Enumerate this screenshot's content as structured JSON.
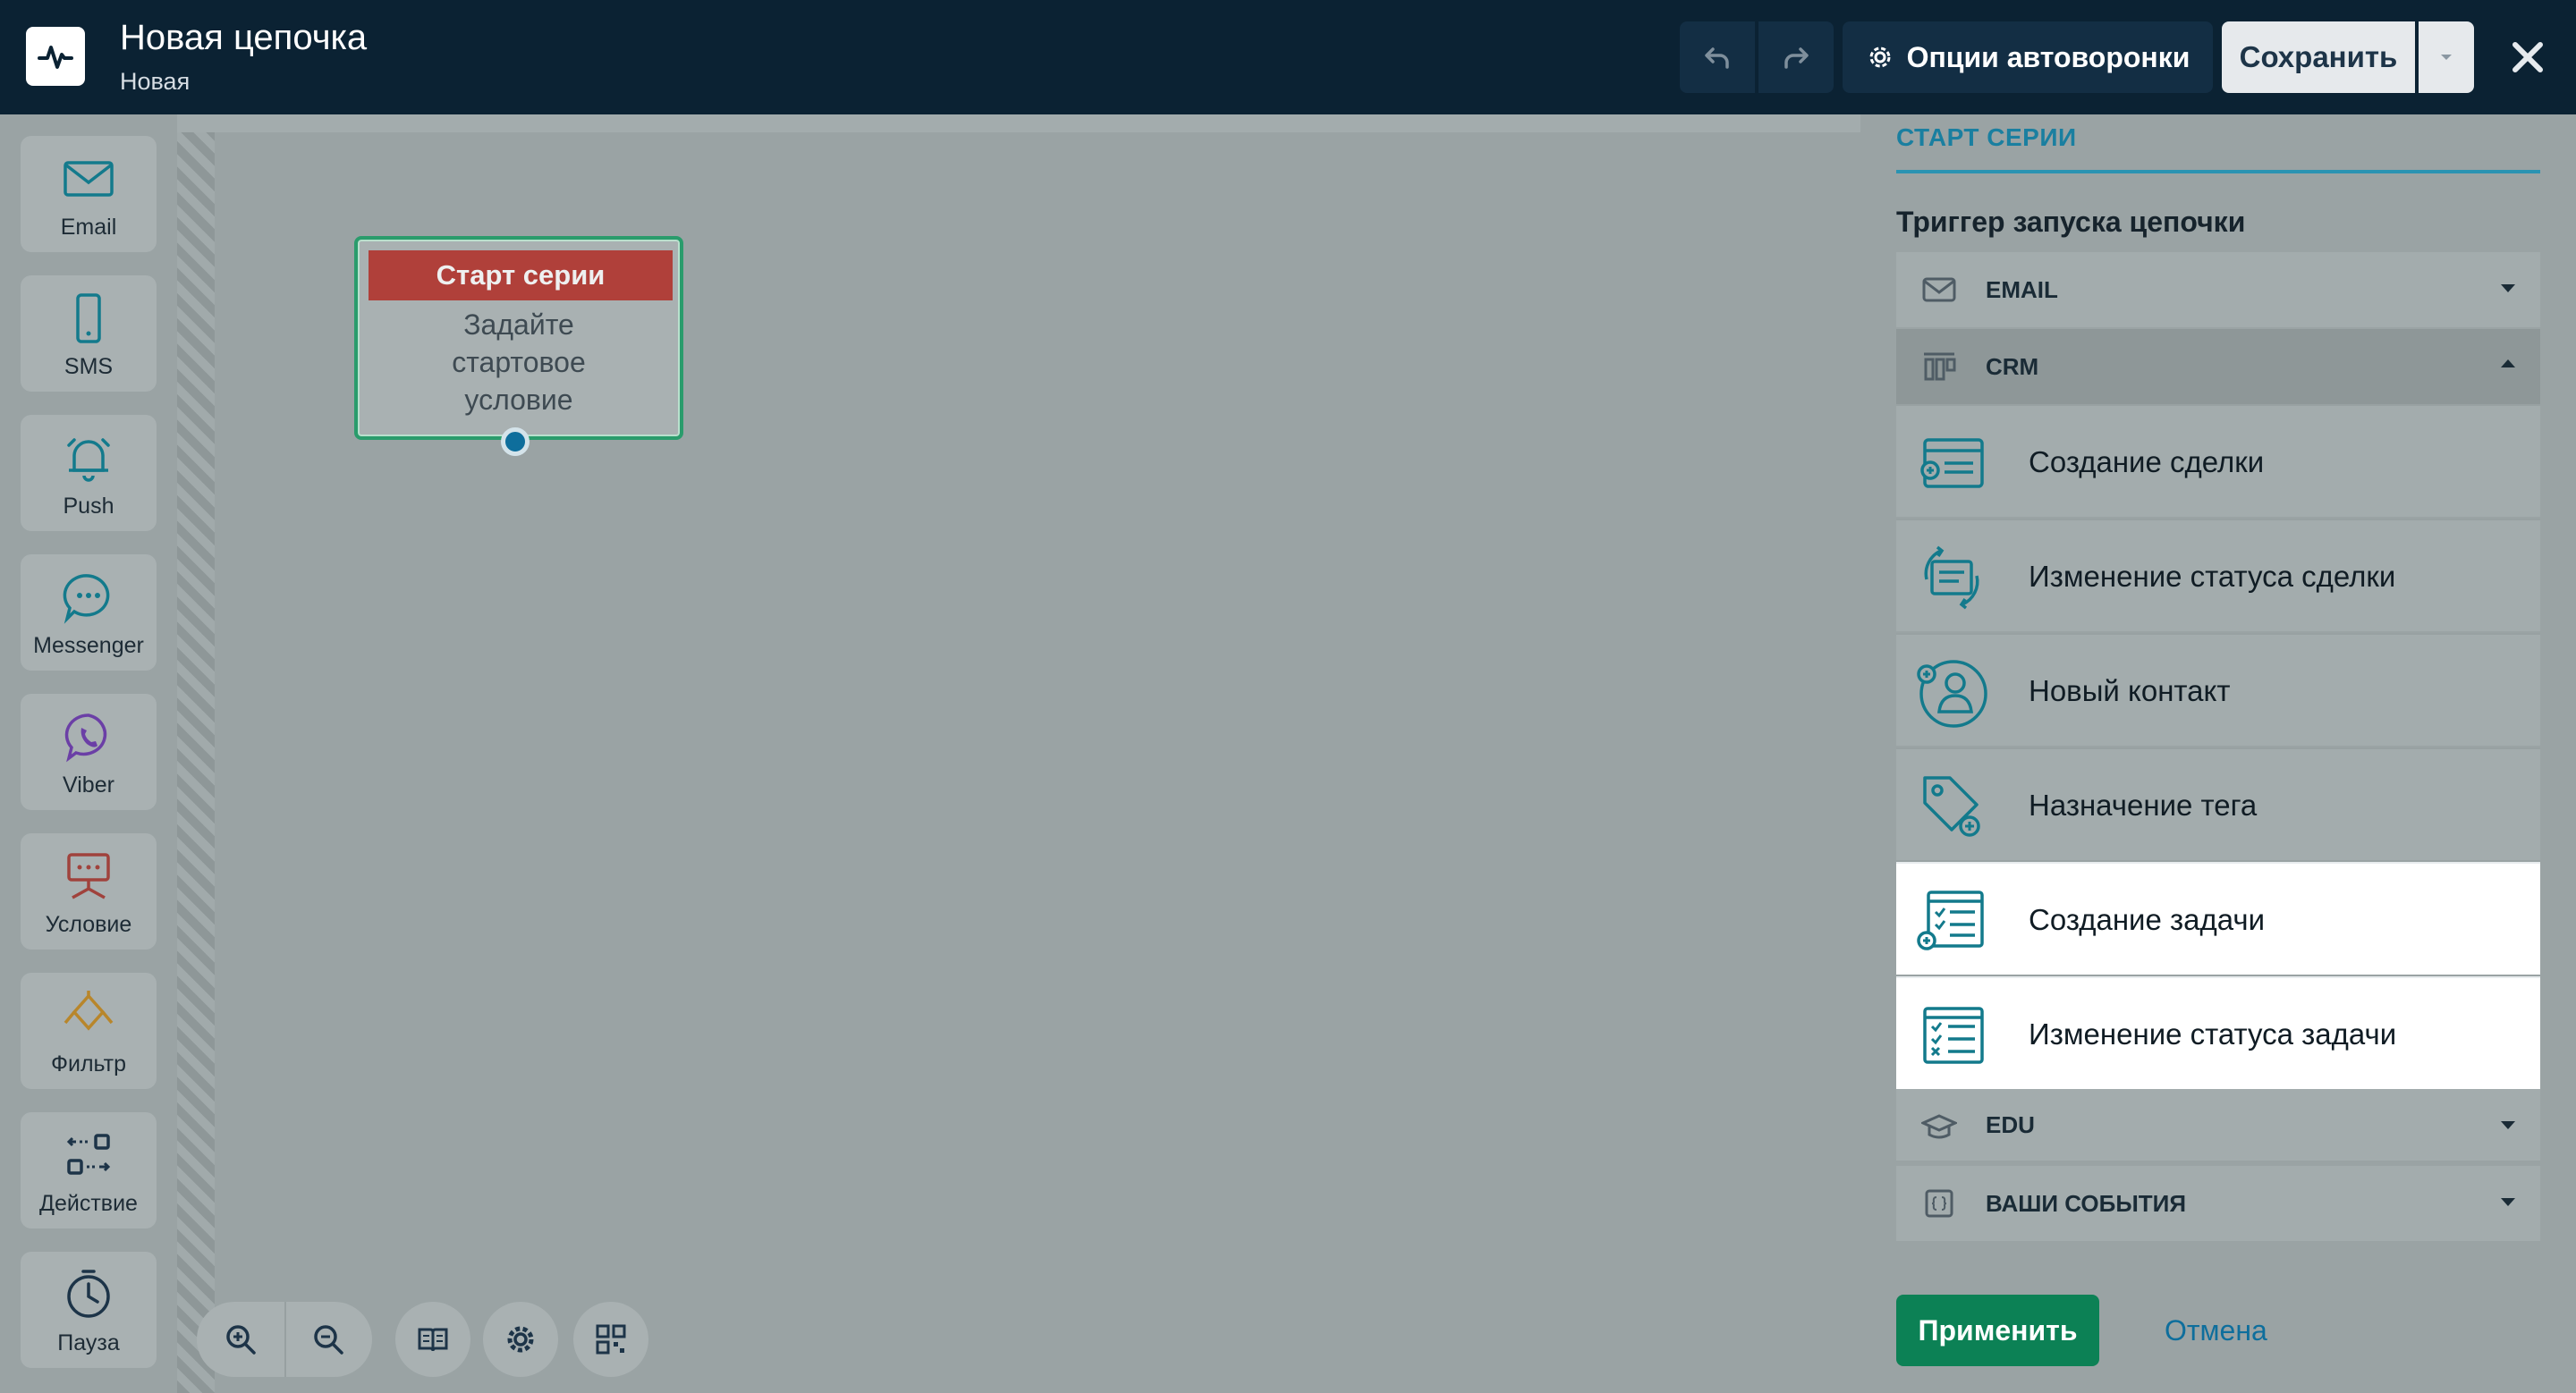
{
  "header": {
    "title": "Новая цепочка",
    "subtitle": "Новая",
    "options_label": "Опции автоворонки",
    "save_label": "Сохранить"
  },
  "toolbar": {
    "items": [
      {
        "label": "Email",
        "icon": "envelope-icon"
      },
      {
        "label": "SMS",
        "icon": "phone-icon"
      },
      {
        "label": "Push",
        "icon": "bell-icon"
      },
      {
        "label": "Messenger",
        "icon": "chat-bubble-icon"
      },
      {
        "label": "Viber",
        "icon": "viber-icon"
      },
      {
        "label": "Условие",
        "icon": "condition-icon"
      },
      {
        "label": "Фильтр",
        "icon": "filter-icon"
      },
      {
        "label": "Действие",
        "icon": "action-icon"
      },
      {
        "label": "Пауза",
        "icon": "clock-icon"
      }
    ]
  },
  "canvas": {
    "node": {
      "title": "Старт серии",
      "body_line1": "Задайте",
      "body_line2": "стартовое",
      "body_line3": "условие"
    }
  },
  "panel": {
    "tab": "СТАРТ СЕРИИ",
    "heading": "Триггер запуска цепочки",
    "categories": {
      "email": "EMAIL",
      "crm": "CRM",
      "edu": "EDU",
      "events": "ВАШИ СОБЫТИЯ"
    },
    "crm_items": [
      {
        "label": "Создание сделки",
        "icon": "deal-create-icon"
      },
      {
        "label": "Изменение статуса сделки",
        "icon": "deal-status-icon"
      },
      {
        "label": "Новый контакт",
        "icon": "new-contact-icon"
      },
      {
        "label": "Назначение тега",
        "icon": "tag-icon"
      },
      {
        "label": "Создание задачи",
        "icon": "task-create-icon"
      },
      {
        "label": "Изменение статуса задачи",
        "icon": "task-status-icon"
      }
    ],
    "apply_label": "Применить",
    "cancel_label": "Отмена"
  },
  "colors": {
    "header_bg": "#0b2233",
    "accent_blue": "#1a7fa0",
    "apply_green": "#0c8155",
    "node_red": "#b0403a",
    "node_border": "#2a9c6c"
  }
}
